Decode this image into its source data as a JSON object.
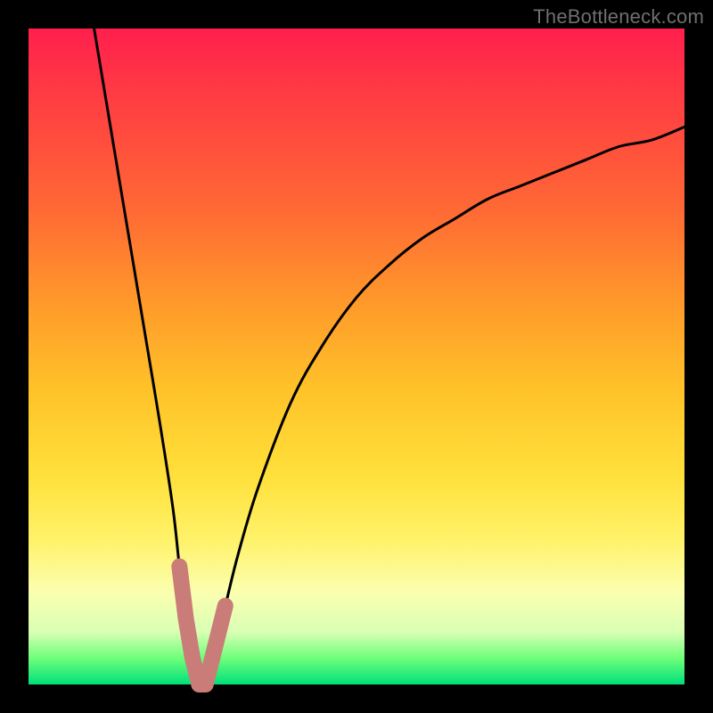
{
  "watermark": "TheBottleneck.com",
  "colors": {
    "background": "#000000",
    "gradient_top": "#ff1f4d",
    "gradient_mid1": "#ff9a2a",
    "gradient_mid2": "#ffe03a",
    "gradient_bottom": "#00e07a",
    "curve": "#000000",
    "marker": "#c97c78"
  },
  "chart_data": {
    "type": "line",
    "title": "",
    "xlabel": "",
    "ylabel": "",
    "xlim": [
      0,
      100
    ],
    "ylim": [
      0,
      100
    ],
    "grid": false,
    "legend": false,
    "series": [
      {
        "name": "curve",
        "x": [
          10,
          12,
          14,
          16,
          18,
          20,
          22,
          23,
          24,
          25,
          26,
          27,
          28,
          30,
          32,
          35,
          40,
          45,
          50,
          55,
          60,
          65,
          70,
          75,
          80,
          85,
          90,
          95,
          100
        ],
        "values": [
          100,
          88,
          76,
          64,
          52,
          40,
          27,
          18,
          10,
          4,
          0,
          0,
          4,
          12,
          20,
          30,
          43,
          52,
          59,
          64,
          68,
          71,
          74,
          76,
          78,
          80,
          82,
          83,
          85
        ]
      }
    ],
    "markers": {
      "name": "bottom-highlight",
      "x_range": [
        23,
        30
      ],
      "style": "thick-rounded",
      "color": "#c97c78"
    },
    "notes": "V-shaped curve on vertical red-to-green gradient. Minimum near x≈26. Right branch asymptotically rises. Values estimated from pixels; no axes/ticks visible."
  }
}
